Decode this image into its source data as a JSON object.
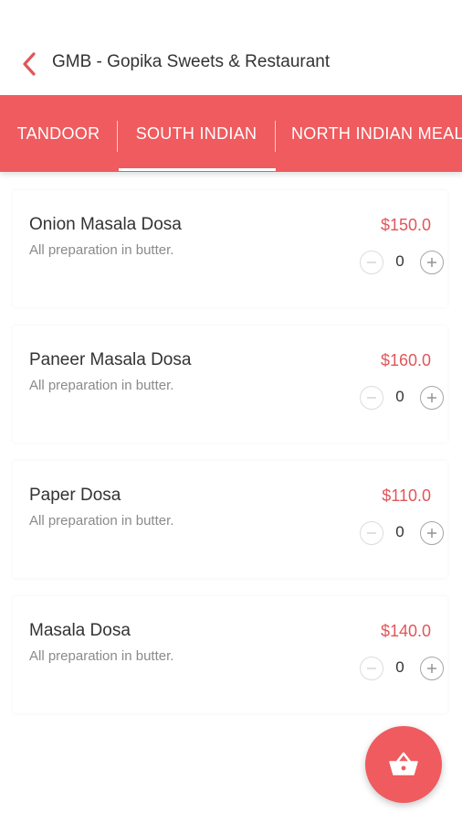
{
  "header": {
    "title": "GMB - Gopika Sweets & Restaurant",
    "back_icon": "chevron-left-icon"
  },
  "tabs": [
    {
      "label": "TANDOOR"
    },
    {
      "label": "SOUTH INDIAN",
      "selected": true
    },
    {
      "label": "NORTH INDIAN MEALS"
    }
  ],
  "items": [
    {
      "name": "Onion Masala Dosa",
      "description": "All preparation in butter.",
      "price": "$150.0",
      "quantity": "0"
    },
    {
      "name": "Paneer Masala Dosa",
      "description": "All preparation in butter.",
      "price": "$160.0",
      "quantity": "0"
    },
    {
      "name": "Paper Dosa",
      "description": "All preparation in butter.",
      "price": "$110.0",
      "quantity": "0"
    },
    {
      "name": "Masala Dosa",
      "description": "All preparation in butter.",
      "price": "$140.0",
      "quantity": "0"
    }
  ],
  "cart_fab": {
    "icon": "basket-icon"
  },
  "colors": {
    "accent": "#ef5b5e",
    "price": "#e0565a",
    "title_text": "#333333",
    "desc_text": "#8a8a8a"
  }
}
